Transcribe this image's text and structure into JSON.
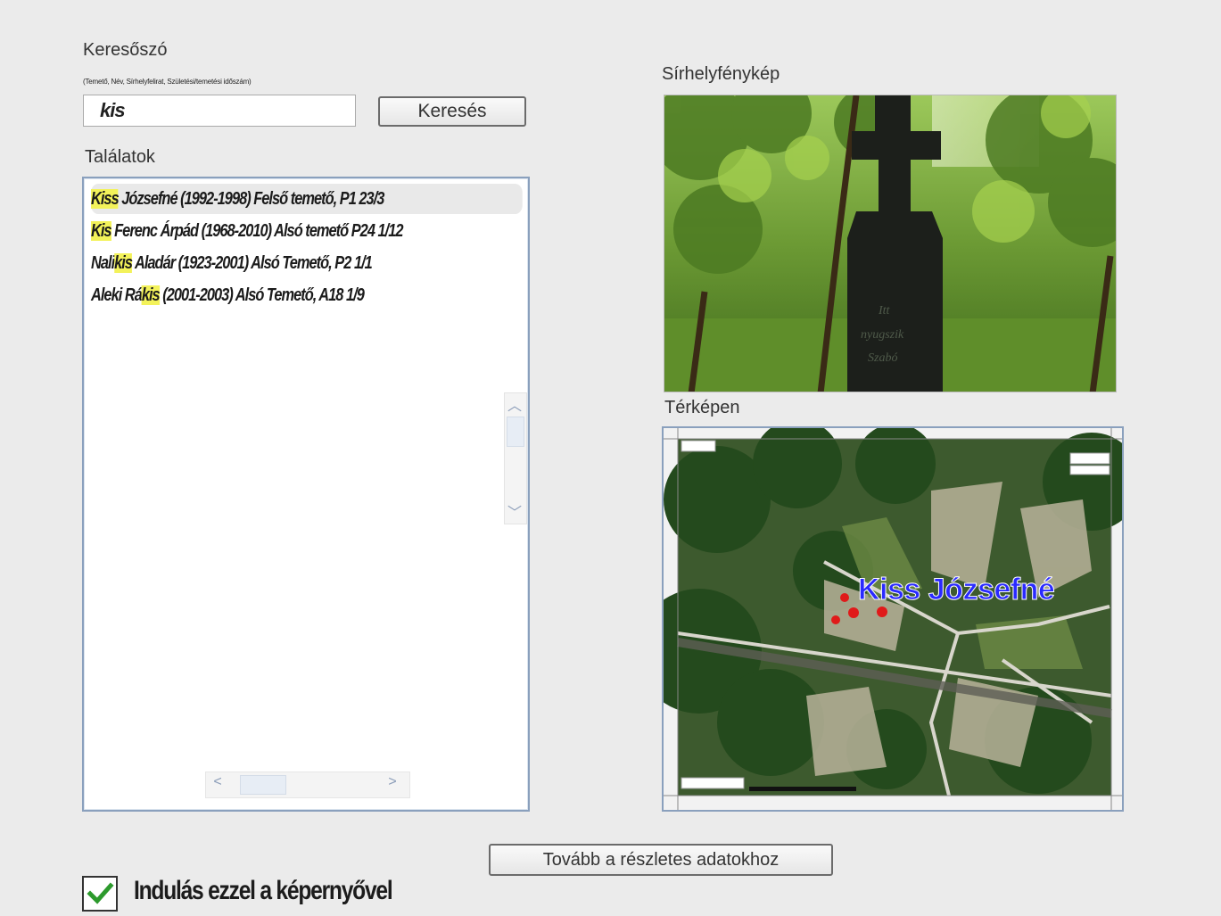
{
  "search": {
    "label": "Keresőszó",
    "hint": "(Temető, Név, Sírhelyfelirat, Születési/temetési időszám)",
    "value": "kis",
    "button_label": "Keresés"
  },
  "results": {
    "label": "Találatok",
    "items": [
      {
        "pre": "",
        "match": "Kiss",
        "post": " Józsefné (1992-1998) Felső temető, P1 23/3"
      },
      {
        "pre": "",
        "match": "Kis",
        "post": " Ferenc Árpád (1968-2010) Alsó temető P24 1/12"
      },
      {
        "pre": "Nali",
        "match": "kis",
        "post": " Aladár (1923-2001) Alsó Temető, P2 1/1"
      },
      {
        "pre": "Aleki Rá",
        "match": "kis",
        "post": " (2001-2003) Alsó Temető, A18 1/9"
      }
    ]
  },
  "photo": {
    "label": "Sírhelyfénykép"
  },
  "map": {
    "label": "Térképen",
    "marker_label": "Kiss Józsefné"
  },
  "details_button": "Tovább a részletes adatokhoz",
  "startup_checkbox": {
    "label": "Indulás ezzel a képernyővel",
    "checked": true
  },
  "colors": {
    "highlight": "#f3f25a",
    "map_label": "#2a2aff",
    "border_blue": "#8aa0bd"
  }
}
